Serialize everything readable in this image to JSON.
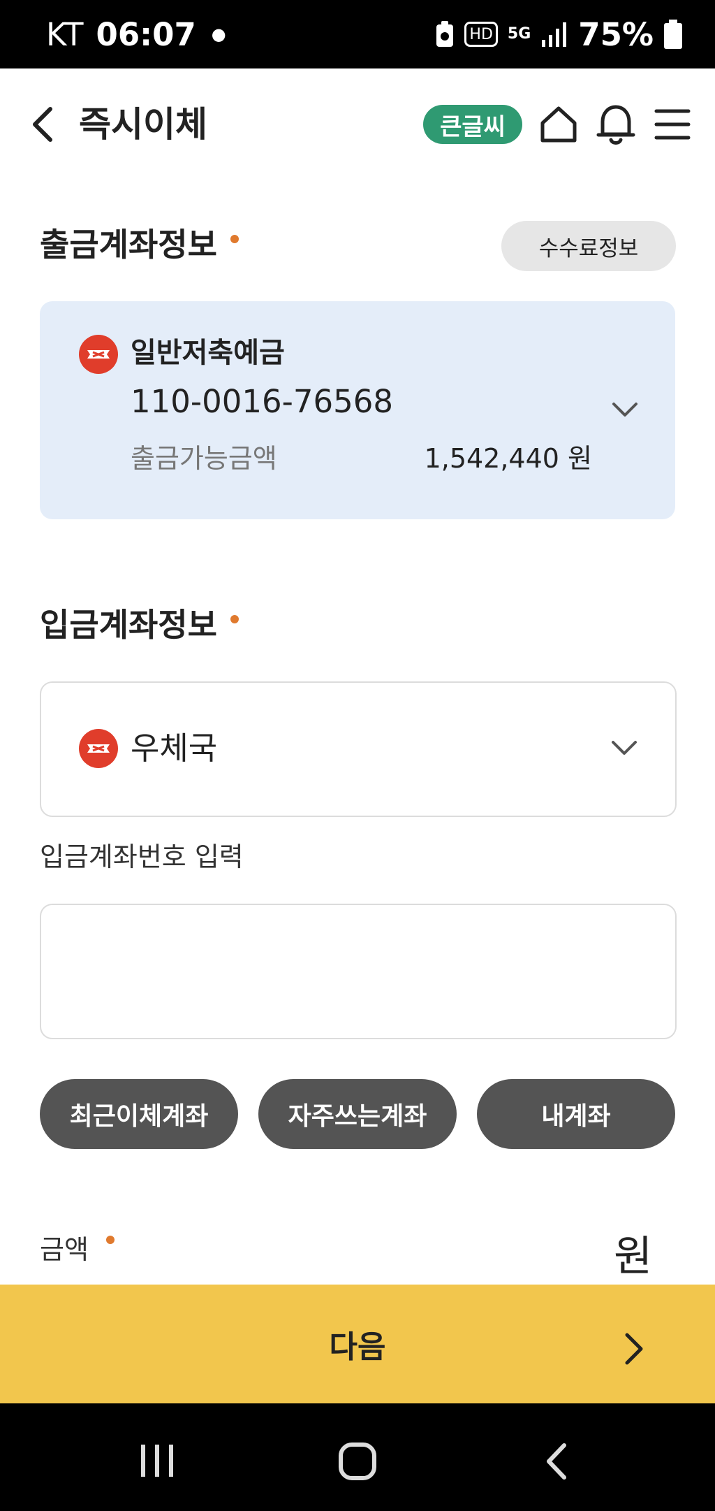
{
  "status_bar": {
    "carrier": "KT",
    "time": "06:07",
    "hd_label": "HD",
    "network": "5G",
    "battery": "75%"
  },
  "header": {
    "title": "즉시이체",
    "big_font_label": "큰글씨"
  },
  "withdrawal": {
    "section_title": "출금계좌정보",
    "fee_button": "수수료정보",
    "account_type": "일반저축예금",
    "account_number": "110-0016-76568",
    "available_label": "출금가능금액",
    "available_amount": "1,542,440 원"
  },
  "deposit": {
    "section_title": "입금계좌정보",
    "bank_name": "우체국",
    "account_input_label": "입금계좌번호 입력",
    "account_input_value": "",
    "shortcuts": [
      "최근이체계좌",
      "자주쓰는계좌",
      "내계좌"
    ]
  },
  "amount": {
    "label": "금액",
    "unit": "원"
  },
  "next_button": "다음",
  "colors": {
    "accent_green": "#2f9a72",
    "required_dot": "#e07a2e",
    "card_bg": "#e4edf9",
    "next_bar": "#f2c64d",
    "bank_logo": "#e03d2b"
  }
}
